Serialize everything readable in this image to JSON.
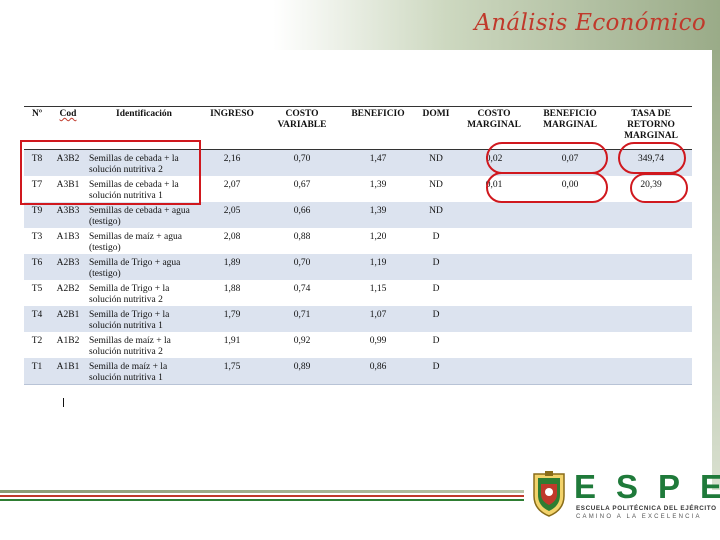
{
  "slide": {
    "title": "Análisis Económico"
  },
  "table": {
    "headers": [
      "Nº",
      "Cod",
      "Identificación",
      "INGRESO",
      "COSTO VARIABLE",
      "BENEFICIO",
      "DOMI",
      "COSTO MARGINAL",
      "BENEFICIO MARGINAL",
      "TASA DE RETORNO MARGINAL"
    ],
    "rows": [
      {
        "n": "T8",
        "cod": "A3B2",
        "ident": "Semillas de cebada + la solución nutritiva 2",
        "ingreso": "2,16",
        "costo": "0,70",
        "beneficio": "1,47",
        "domi": "ND",
        "cmarg": "0,02",
        "bmarg": "0,07",
        "tasa": "349,74"
      },
      {
        "n": "T7",
        "cod": "A3B1",
        "ident": "Semillas de cebada + la solución nutritiva 1",
        "ingreso": "2,07",
        "costo": "0,67",
        "beneficio": "1,39",
        "domi": "ND",
        "cmarg": "0,01",
        "bmarg": "0,00",
        "tasa": "20,39"
      },
      {
        "n": "T9",
        "cod": "A3B3",
        "ident": "Semillas de cebada + agua (testigo)",
        "ingreso": "2,05",
        "costo": "0,66",
        "beneficio": "1,39",
        "domi": "ND",
        "cmarg": "",
        "bmarg": "",
        "tasa": ""
      },
      {
        "n": "T3",
        "cod": "A1B3",
        "ident": "Semillas de maíz + agua (testigo)",
        "ingreso": "2,08",
        "costo": "0,88",
        "beneficio": "1,20",
        "domi": "D",
        "cmarg": "",
        "bmarg": "",
        "tasa": ""
      },
      {
        "n": "T6",
        "cod": "A2B3",
        "ident": "Semilla de Trigo + agua (testigo)",
        "ingreso": "1,89",
        "costo": "0,70",
        "beneficio": "1,19",
        "domi": "D",
        "cmarg": "",
        "bmarg": "",
        "tasa": ""
      },
      {
        "n": "T5",
        "cod": "A2B2",
        "ident": "Semilla de Trigo + la solución nutritiva 2",
        "ingreso": "1,88",
        "costo": "0,74",
        "beneficio": "1,15",
        "domi": "D",
        "cmarg": "",
        "bmarg": "",
        "tasa": ""
      },
      {
        "n": "T4",
        "cod": "A2B1",
        "ident": "Semilla de Trigo + la solución nutritiva 1",
        "ingreso": "1,79",
        "costo": "0,71",
        "beneficio": "1,07",
        "domi": "D",
        "cmarg": "",
        "bmarg": "",
        "tasa": ""
      },
      {
        "n": "T2",
        "cod": "A1B2",
        "ident": "Semillas de maíz + la solución nutritiva 2",
        "ingreso": "1,91",
        "costo": "0,92",
        "beneficio": "0,99",
        "domi": "D",
        "cmarg": "",
        "bmarg": "",
        "tasa": ""
      },
      {
        "n": "T1",
        "cod": "A1B1",
        "ident": "Semilla de maíz + la solución nutritiva 1",
        "ingreso": "1,75",
        "costo": "0,89",
        "beneficio": "0,86",
        "domi": "D",
        "cmarg": "",
        "bmarg": "",
        "tasa": ""
      }
    ]
  },
  "footer": {
    "logo_word": "ESPE",
    "logo_sub1": "ESCUELA POLITÉCNICA DEL EJÉRCITO",
    "logo_sub2": "CAMINO A LA EXCELENCIA"
  },
  "colors": {
    "title": "#c0392b",
    "highlight": "#d0181e",
    "row_band": "#dce3ef",
    "logo_green": "#1f7a3a"
  }
}
